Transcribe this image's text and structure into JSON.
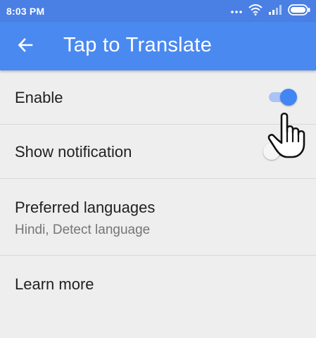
{
  "status_bar": {
    "time": "8:03 PM",
    "icons": [
      "dots-icon",
      "wifi-icon",
      "signal-icon",
      "battery-icon"
    ]
  },
  "app_bar": {
    "back_icon": "back-arrow-icon",
    "title": "Tap to Translate",
    "color": "#4a89f0"
  },
  "settings": {
    "enable": {
      "label": "Enable",
      "toggle_state": "on"
    },
    "show_notification": {
      "label": "Show notification",
      "toggle_state": "off"
    },
    "preferred_languages": {
      "label": "Preferred languages",
      "value": "Hindi, Detect language"
    },
    "learn_more": {
      "label": "Learn more"
    }
  },
  "accent_color": "#4285f4",
  "cursor_icon": "hand-pointer-icon"
}
